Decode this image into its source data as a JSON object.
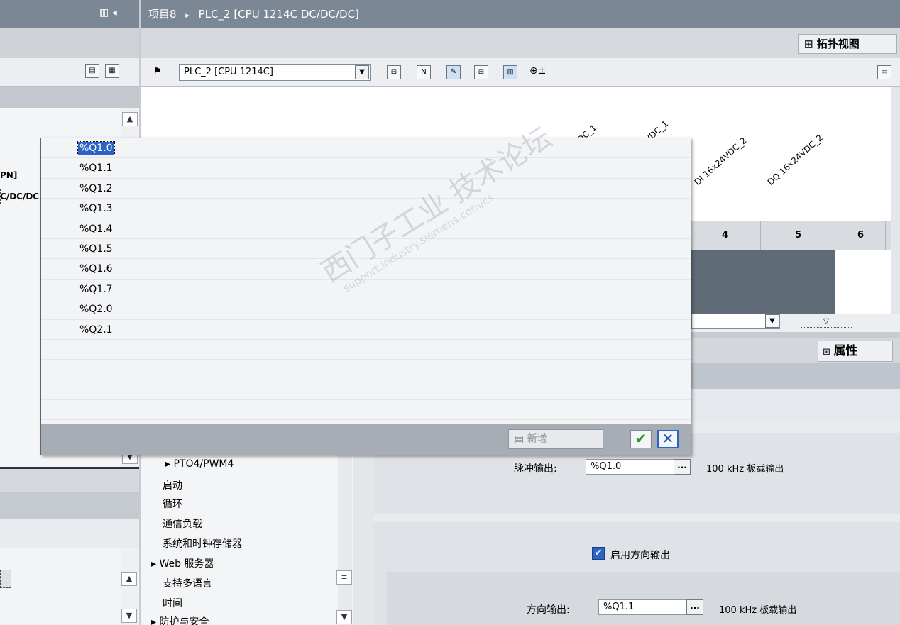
{
  "breadcrumb": {
    "project": "项目8",
    "separator": "▸",
    "device": "PLC_2 [CPU 1214C DC/DC/DC]"
  },
  "left_pane": {
    "pane_controls": "▥ ◂",
    "tree_items": [
      "PN]",
      "C/DC/DC"
    ]
  },
  "tabs": {
    "topology": "拓扑视图"
  },
  "toolbar": {
    "device_select_value": "PLC_2 [CPU 1214C]",
    "zoom_icon": "⊕±"
  },
  "device_view": {
    "slot_labels": [
      "DC_1",
      "VDC_1",
      "DI 16x24VDC_2",
      "DQ 16x24VDC_2"
    ],
    "rack_slots": [
      "4",
      "5",
      "6"
    ]
  },
  "properties": {
    "tab_label": "属性"
  },
  "nav": {
    "items": [
      {
        "label": "PTO4/PWM4",
        "expander": "▸"
      },
      {
        "label": "启动"
      },
      {
        "label": "循环"
      },
      {
        "label": "通信负载"
      },
      {
        "label": "系统和时钟存储器"
      },
      {
        "label": "Web 服务器",
        "expander": "▸"
      },
      {
        "label": "支持多语言"
      },
      {
        "label": "时间"
      },
      {
        "label": "防护与安全",
        "expander": "▸"
      }
    ]
  },
  "pulse": {
    "label": "脉冲输出:",
    "value": "%Q1.0",
    "dots": "...",
    "note": "100 kHz 板载输出"
  },
  "direction": {
    "checkbox_label": "启用方向输出",
    "checked": true,
    "label": "方向输出:",
    "value": "%Q1.1",
    "dots": "...",
    "note": "100 kHz 板载输出"
  },
  "popup": {
    "addresses": [
      "%Q1.0",
      "%Q1.1",
      "%Q1.2",
      "%Q1.3",
      "%Q1.4",
      "%Q1.5",
      "%Q1.6",
      "%Q1.7",
      "%Q2.0",
      "%Q2.1"
    ],
    "selected_index": 0,
    "new_button": "新增",
    "ok_symbol": "✔",
    "cancel_symbol": "✕",
    "watermark": "西门子工业 技术论坛",
    "watermark_url": "support.industry.siemens.com/cs"
  },
  "colors": {
    "title_bar": "#7b8795",
    "selection": "#2b63c6",
    "ok_green": "#2b9a2b"
  }
}
